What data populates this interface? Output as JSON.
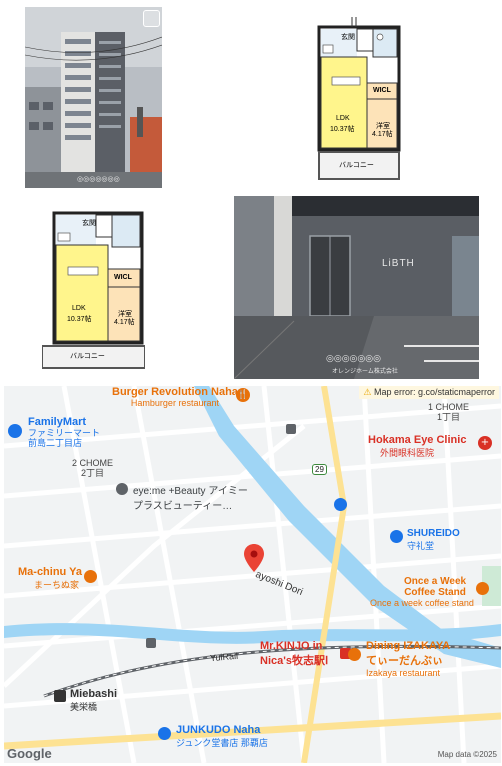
{
  "photos": {
    "building_watermark": "◎◎◎◎◎◎◎",
    "entrance_sign": "LiBTH",
    "entrance_watermark": "◎◎◎◎◎◎◎",
    "entrance_watermark_sub": "オレンジホーム株式会社"
  },
  "floorplan_1": {
    "entrance": "玄関",
    "wicl": "WICL",
    "ldk": "LDK",
    "ldk_size": "10.37帖",
    "western": "洋室",
    "western_size": "4.17帖",
    "balcony": "バルコニー"
  },
  "floorplan_2": {
    "entrance": "玄関",
    "wicl": "WICL",
    "ldk": "LDK",
    "ldk_size": "10.37帖",
    "western": "洋室",
    "western_size": "4.17帖",
    "balcony": "バルコニー"
  },
  "map": {
    "error_text": "Map error: g.co/staticmaperror",
    "attribution": "Map data ©2025",
    "google_logo": "Google",
    "route_badge": "29",
    "pois": [
      {
        "name": "Burger Revolution Naha",
        "sub": "Hamburger restaurant",
        "color": "#e8710a"
      },
      {
        "name": "FamilyMart",
        "sub": "ファミリーマート\n前島二丁目店",
        "color": "#1a73e8"
      },
      {
        "name": "Hokama Eye Clinic",
        "sub": "外間眼科医院",
        "color": "#d93025"
      },
      {
        "name": "eye:me +Beauty アイミー",
        "sub": "プラスビューティー…",
        "color": "#5f6368"
      },
      {
        "name": "SHUREIDO",
        "sub": "守礼堂",
        "color": "#1a73e8"
      },
      {
        "name": "Ma-chinu Ya",
        "sub": "まーちぬ家",
        "color": "#e8710a"
      },
      {
        "name": "Once a Week",
        "sub": "Coffee Stand",
        "color": "#e8710a"
      },
      {
        "name": "Mr.KINJO in",
        "sub": "Nica's牧志駅Ⅰ",
        "color": "#d93025"
      },
      {
        "name": "Dining IZAKAYA",
        "sub": "てぃーだんぶぃ",
        "color": "#e8710a"
      },
      {
        "name": "Miebashi",
        "sub": "美栄橋",
        "color": "#333333"
      },
      {
        "name": "JUNKUDO Naha",
        "sub": "ジュンク堂書店 那覇店",
        "color": "#1a73e8"
      }
    ],
    "once_a_week_extra": "Once a week coffee stand",
    "izakaya_extra": "Izakaya restaurant",
    "areas": {
      "chome1": "1 CHOME\n1丁目",
      "chome2": "2 CHOME\n2丁目"
    },
    "roads": {
      "dori": "ayoshi Dori",
      "yuirail": "YuiRail"
    },
    "colors": {
      "water": "#9fd5f5",
      "road_yellow": "#fde293",
      "food": "#e8710a",
      "shop": "#1a73e8",
      "health": "#d93025",
      "pin": "#ea4335"
    }
  }
}
